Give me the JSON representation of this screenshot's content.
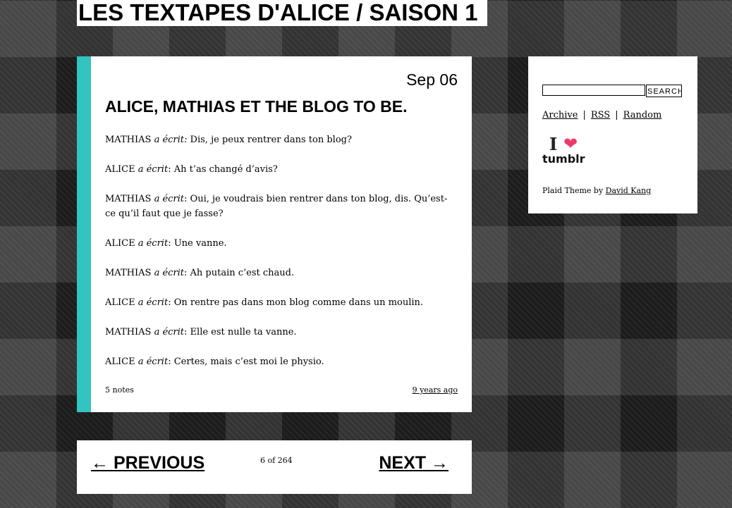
{
  "site": {
    "title": "LES TEXTAPES D'ALICE / SAISON 1"
  },
  "post": {
    "date": "Sep 06",
    "title": "ALICE, MATHIAS ET THE BLOG TO BE.",
    "lines": [
      {
        "speaker": "MATHIAS",
        "wrote": "a écrit:",
        "text": " Dis, je peux rentrer dans ton blog?"
      },
      {
        "speaker": "ALICE",
        "wrote": "a écrit",
        "text": ": Ah t’as changé d’avis?"
      },
      {
        "speaker": "MATHIAS",
        "wrote": "a écrit",
        "text": ": Oui, je voudrais bien rentrer dans ton blog, dis. Qu’est-ce qu’il faut que je fasse?"
      },
      {
        "speaker": "ALICE",
        "wrote": "a écrit",
        "text": ": Une vanne."
      },
      {
        "speaker": "MATHIAS",
        "wrote": "a écrit",
        "text": ": Ah putain c’est chaud."
      },
      {
        "speaker": "ALICE",
        "wrote": "a écrit",
        "text": ": On rentre pas dans mon blog comme dans un moulin."
      },
      {
        "speaker": "MATHIAS",
        "wrote": "a écrit",
        "text": ": Elle est nulle ta vanne."
      },
      {
        "speaker": "ALICE",
        "wrote": "a écrit",
        "text": ": Certes, mais c’est moi le physio."
      }
    ],
    "notes": "5 notes",
    "time_ago": "9 years ago"
  },
  "sidebar": {
    "search_button": "SEARCH",
    "search_value": "",
    "links": {
      "archive": "Archive",
      "rss": "RSS",
      "random": "Random",
      "separator": "|"
    },
    "badge": {
      "i": "I",
      "heart": "❤",
      "word": "tumblr"
    },
    "credit": {
      "prefix": "Plaid Theme by ",
      "author": "David Kang"
    }
  },
  "pager": {
    "prev": "← PREVIOUS",
    "count": "6 of 264",
    "next": "NEXT →"
  },
  "colors": {
    "accent": "#33c3c0",
    "heart": "#ee3a6a"
  }
}
